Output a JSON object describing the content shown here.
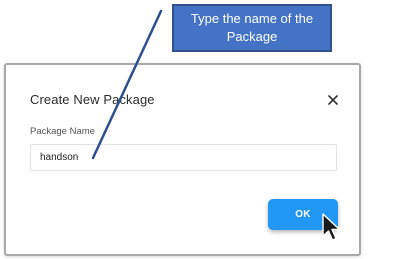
{
  "dialog": {
    "title": "Create New Package",
    "field_label": "Package Name",
    "field_value": "handson",
    "ok_label": "OK",
    "close_symbol": "×"
  },
  "annotation": {
    "callout_text": "Type the name of the Package"
  },
  "colors": {
    "callout_fill": "#4472c4",
    "ok_button": "#2196f3",
    "pointer_line": "#2f4f8f"
  },
  "icons": [
    "close-icon",
    "mouse-cursor-icon"
  ]
}
